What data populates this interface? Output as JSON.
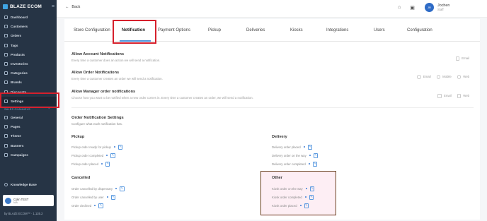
{
  "brand": {
    "name": "BLAZE ECOM"
  },
  "sidebar": {
    "items": [
      {
        "label": "Dashboard",
        "name": "sidebar-item-dashboard"
      },
      {
        "label": "Customers",
        "name": "sidebar-item-customers"
      },
      {
        "label": "Orders",
        "name": "sidebar-item-orders"
      },
      {
        "label": "Tags",
        "name": "sidebar-item-tags"
      },
      {
        "label": "Products",
        "name": "sidebar-item-products"
      },
      {
        "label": "Inventories",
        "name": "sidebar-item-inventories"
      },
      {
        "label": "Categories",
        "name": "sidebar-item-categories"
      },
      {
        "label": "Brands",
        "name": "sidebar-item-brands"
      },
      {
        "label": "Discounts",
        "name": "sidebar-item-discounts"
      },
      {
        "label": "Settings",
        "name": "sidebar-item-settings"
      }
    ],
    "section_label": "SALES CHANNELS",
    "channels": [
      {
        "label": "General",
        "name": "sidebar-item-general"
      },
      {
        "label": "Pages",
        "name": "sidebar-item-pages"
      },
      {
        "label": "Theme",
        "name": "sidebar-item-theme"
      },
      {
        "label": "Banners",
        "name": "sidebar-item-banners"
      },
      {
        "label": "Campaigns",
        "name": "sidebar-item-campaigns"
      }
    ],
    "knowledge": "Knowledge Base",
    "store": {
      "name": "Colin TEST",
      "sub": "N/A"
    },
    "version": "by BLAZE ECOM™ · 1.135.2"
  },
  "topbar": {
    "back": "Back",
    "user": {
      "initials": "JR",
      "name": "Jochen",
      "role": "Staff"
    }
  },
  "tabs": [
    "Store Configuration",
    "Notification",
    "Payment Options",
    "Pickup",
    "Deliveries",
    "Kiosks",
    "Integrations",
    "Users",
    "Configuration"
  ],
  "account": {
    "title": "Allow Account Notifications",
    "desc": "Every time a customer does an action we will send a notification.",
    "opts": [
      "Email"
    ]
  },
  "order": {
    "title": "Allow Order Notifications",
    "desc": "Every time a customer creates an order we will send a notification.",
    "opts": [
      "Email",
      "Mobile",
      "Web"
    ]
  },
  "manager": {
    "title": "Allow Manager order notifications",
    "desc": "Choose how you want to be notified when a new order comes in. Every time a customer creates an order, we will send a notification.",
    "opts": [
      "Email",
      "Web"
    ]
  },
  "settings": {
    "title": "Order Notification Settings",
    "desc": "Configure what each notification has."
  },
  "groups": {
    "pickup": {
      "title": "Pickup",
      "items": [
        "Pickup order ready for pickup",
        "Pickup order completed",
        "Pickup order placed"
      ]
    },
    "delivery": {
      "title": "Delivery",
      "items": [
        "Delivery order placed",
        "Delivery order on the way",
        "Delivery order completed"
      ]
    },
    "cancelled": {
      "title": "Cancelled",
      "items": [
        "Order cancelled by dispensary",
        "Order cancelled by user",
        "Order declined"
      ]
    },
    "other": {
      "title": "Other",
      "items": [
        "Kiosk order on the way",
        "Kiosk order completed",
        "Kiosk order placed"
      ]
    }
  },
  "colors": {
    "sidebar": "#263445",
    "accent": "#3a7bd5",
    "highlight": "#d6202c",
    "other_highlight": "#6b4423"
  }
}
